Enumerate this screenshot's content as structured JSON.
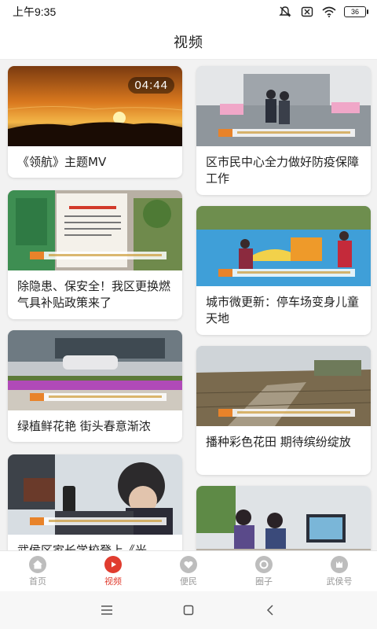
{
  "status": {
    "time": "上午9:35",
    "battery": "36"
  },
  "header": {
    "title": "视频"
  },
  "feed": {
    "left": [
      {
        "caption": "《领航》主题MV",
        "duration": "04:44"
      },
      {
        "caption": "除隐患、保安全！我区更换燃气具补贴政策来了"
      },
      {
        "caption": "绿植鲜花艳 街头春意渐浓"
      },
      {
        "caption": "武侯区家长学校登上《光"
      }
    ],
    "right": [
      {
        "caption": "区市民中心全力做好防疫保障工作"
      },
      {
        "caption": "城市微更新：停车场变身儿童天地"
      },
      {
        "caption": "播种彩色花田 期待缤纷绽放"
      },
      {
        "caption": ""
      }
    ]
  },
  "tabbar": {
    "tabs": [
      {
        "label": "首页",
        "icon": "home-icon"
      },
      {
        "label": "视频",
        "icon": "play-icon",
        "active": true
      },
      {
        "label": "便民",
        "icon": "heart-hands-icon"
      },
      {
        "label": "圈子",
        "icon": "circle-icon"
      },
      {
        "label": "武侯号",
        "icon": "badge-icon"
      }
    ]
  },
  "colors": {
    "accent": "#e03c2f",
    "tab_inactive": "#999999",
    "background": "#f2f2f2"
  }
}
